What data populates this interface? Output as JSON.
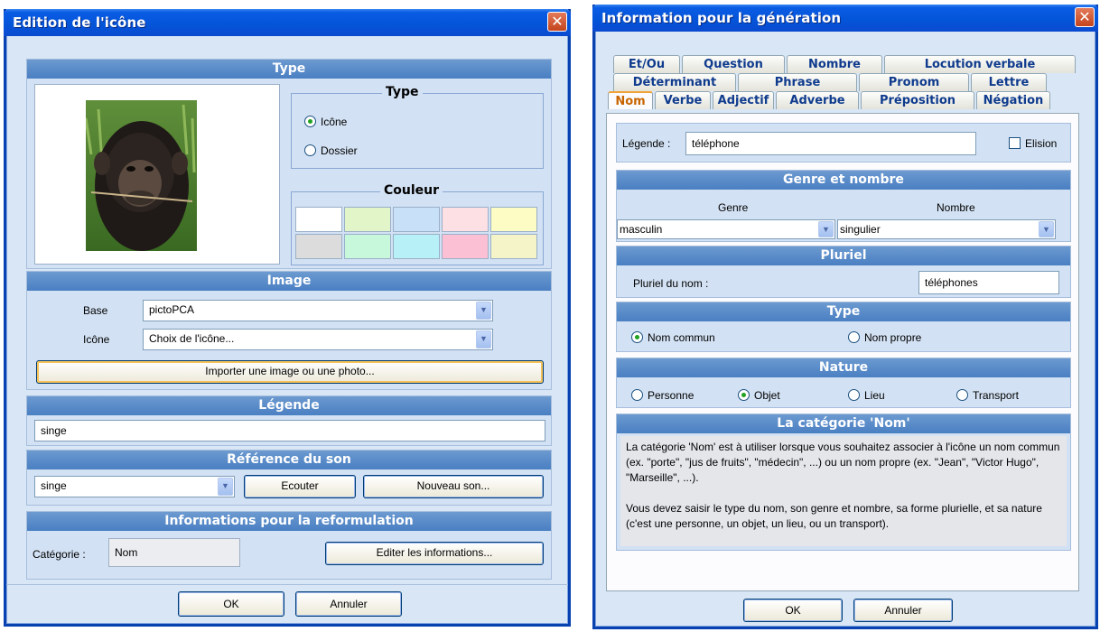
{
  "left": {
    "title": "Edition de l'icône",
    "close": "✕",
    "type_panel": {
      "header": "Type",
      "type_group": {
        "title": "Type",
        "options": [
          "Icône",
          "Dossier"
        ],
        "selected": "Icône"
      },
      "color_group": {
        "title": "Couleur",
        "swatches": [
          "#ffffff",
          "#e1f5c8",
          "#c8e0f8",
          "#fde0e4",
          "#fcfcc4",
          "#dcdcdc",
          "#c8f8dc",
          "#b8f0f8",
          "#fcc0d4",
          "#f4f4c8"
        ]
      }
    },
    "image_panel": {
      "header": "Image",
      "base_label": "Base",
      "base_value": "pictoPCA",
      "icone_label": "Icône",
      "icone_value": "Choix de l'icône...",
      "import_button": "Importer une image ou une photo..."
    },
    "legende_panel": {
      "header": "Légende",
      "value": "singe"
    },
    "son_panel": {
      "header": "Référence du son",
      "value": "singe",
      "listen_button": "Ecouter",
      "new_button": "Nouveau son..."
    },
    "reform_panel": {
      "header": "Informations pour la reformulation",
      "category_label": "Catégorie :",
      "category_value": "Nom",
      "edit_button": "Editer les informations..."
    },
    "ok": "OK",
    "cancel": "Annuler"
  },
  "right": {
    "title": "Information pour la génération",
    "close": "✕",
    "tabs_row1": [
      "Et/Ou",
      "Question",
      "Nombre",
      "Locution verbale"
    ],
    "tabs_row2": [
      "Déterminant",
      "Phrase",
      "Pronom",
      "Lettre"
    ],
    "tabs_row3": [
      "Nom",
      "Verbe",
      "Adjectif",
      "Adverbe",
      "Préposition",
      "Négation"
    ],
    "selected_tab": "Nom",
    "legende_label": "Légende :",
    "legende_value": "téléphone",
    "elision_label": "Elision",
    "genre_panel": {
      "header": "Genre et nombre",
      "genre_label": "Genre",
      "nombre_label": "Nombre",
      "genre_value": "masculin",
      "nombre_value": "singulier"
    },
    "pluriel_panel": {
      "header": "Pluriel",
      "label": "Pluriel du nom :",
      "value": "téléphones"
    },
    "type_panel": {
      "header": "Type",
      "options": [
        "Nom commun",
        "Nom propre"
      ],
      "selected": "Nom commun"
    },
    "nature_panel": {
      "header": "Nature",
      "options": [
        "Personne",
        "Objet",
        "Lieu",
        "Transport"
      ],
      "selected": "Objet"
    },
    "categorie_panel": {
      "header": "La catégorie 'Nom'",
      "text": "La catégorie 'Nom' est à utiliser lorsque vous souhaitez associer à l'icône un nom commun (ex. \"porte\", \"jus de fruits\", \"médecin\", ...) ou un nom propre (ex. \"Jean\", \"Victor Hugo\", \"Marseille\", ...).\n\nVous devez saisir le type du nom, son genre et nombre, sa forme plurielle, et sa nature (c'est une personne, un objet, un lieu, ou un transport)."
    },
    "ok": "OK",
    "cancel": "Annuler"
  }
}
